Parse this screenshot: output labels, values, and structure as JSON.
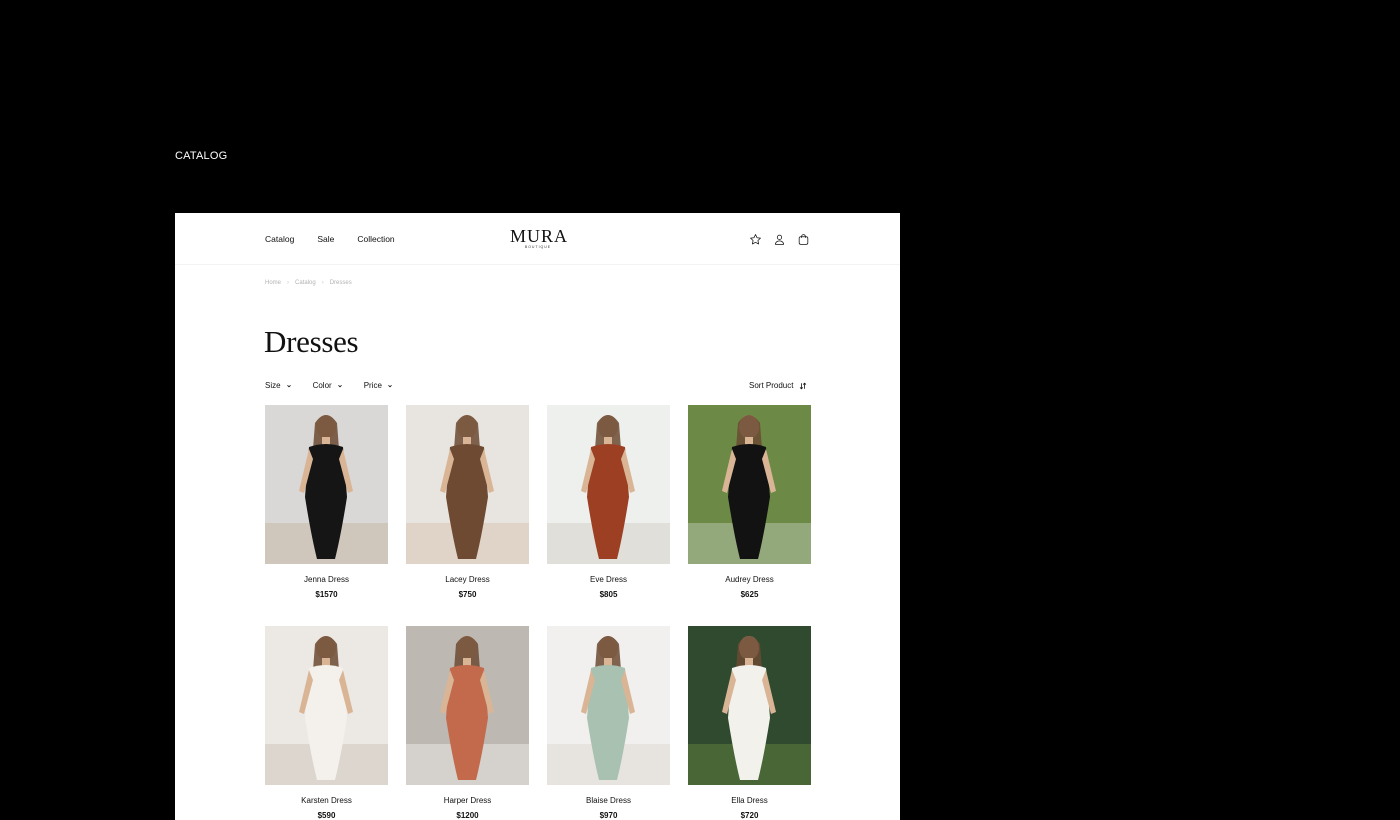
{
  "section_label": "CATALOG",
  "header": {
    "nav": [
      "Catalog",
      "Sale",
      "Collection"
    ],
    "logo": {
      "main": "MURA",
      "sub": "BOUTIQUE"
    },
    "icons": [
      "star-icon",
      "user-icon",
      "bag-icon"
    ]
  },
  "breadcrumb": [
    "Home",
    "Catalog",
    "Dresses"
  ],
  "page_title": "Dresses",
  "filters": [
    "Size",
    "Color",
    "Price"
  ],
  "sort_label": "Sort Product",
  "products": [
    {
      "name": "Jenna Dress",
      "price": "$1570",
      "bg": "#d9d8d6",
      "dress": "#151515",
      "accent": "#c9b9a8"
    },
    {
      "name": "Lacey Dress",
      "price": "$750",
      "bg": "#e8e5e1",
      "dress": "#6e4a33",
      "accent": "#d8c7b6"
    },
    {
      "name": "Eve Dress",
      "price": "$805",
      "bg": "#eef0ee",
      "dress": "#9c3f22",
      "accent": "#d7d2c8"
    },
    {
      "name": "Audrey Dress",
      "price": "$625",
      "bg": "#6c8a45",
      "dress": "#121212",
      "accent": "#b7c3a8"
    },
    {
      "name": "Karsten Dress",
      "price": "$590",
      "bg": "#ece9e5",
      "dress": "#f4f1ec",
      "accent": "#cfc7bd"
    },
    {
      "name": "Harper Dress",
      "price": "$1200",
      "bg": "#bdb8b2",
      "dress": "#c26a4b",
      "accent": "#e9e6e2"
    },
    {
      "name": "Blaise Dress",
      "price": "$970",
      "bg": "#f1f0ee",
      "dress": "#a9c1b1",
      "accent": "#dedbd6"
    },
    {
      "name": "Ella Dress",
      "price": "$720",
      "bg": "#2f4a2e",
      "dress": "#f3f1ec",
      "accent": "#5f7d3e"
    }
  ]
}
